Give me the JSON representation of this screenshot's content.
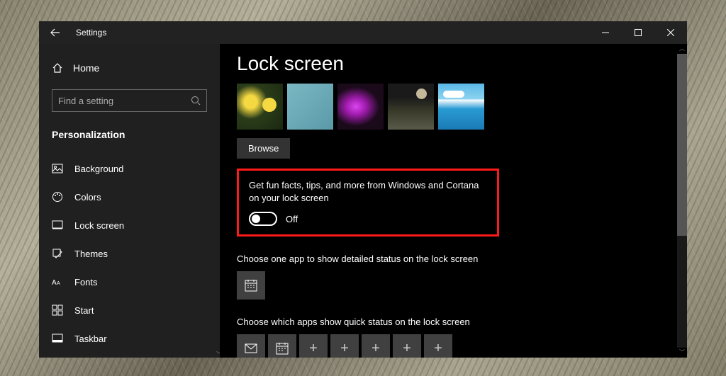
{
  "window": {
    "title": "Settings"
  },
  "sidebar": {
    "home": "Home",
    "search_placeholder": "Find a setting",
    "category": "Personalization",
    "items": [
      {
        "label": "Background",
        "icon": "image-icon"
      },
      {
        "label": "Colors",
        "icon": "palette-icon"
      },
      {
        "label": "Lock screen",
        "icon": "lockscreen-icon"
      },
      {
        "label": "Themes",
        "icon": "themes-icon"
      },
      {
        "label": "Fonts",
        "icon": "fonts-icon"
      },
      {
        "label": "Start",
        "icon": "start-icon"
      },
      {
        "label": "Taskbar",
        "icon": "taskbar-icon"
      }
    ]
  },
  "main": {
    "title": "Lock screen",
    "browse": "Browse",
    "fun_facts": {
      "text": "Get fun facts, tips, and more from Windows and Cortana on your lock screen",
      "state": "Off"
    },
    "detailed": {
      "text": "Choose one app to show detailed status on the lock screen",
      "app": "calendar"
    },
    "quick": {
      "text": "Choose which apps show quick status on the lock screen",
      "slots": [
        "mail",
        "calendar",
        "plus",
        "plus",
        "plus",
        "plus",
        "plus"
      ]
    }
  }
}
